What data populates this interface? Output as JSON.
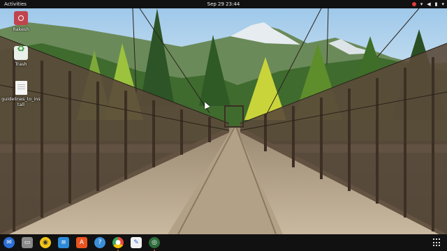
{
  "topbar": {
    "activities_label": "Activities",
    "clock": "Sep 29  23:44"
  },
  "desktop": {
    "icons": [
      {
        "label": "Rakesh",
        "icon": "home-folder-icon"
      },
      {
        "label": "Trash",
        "icon": "trash-icon"
      },
      {
        "label": "guidelines_to_install",
        "icon": "text-file-icon"
      }
    ]
  },
  "dock": {
    "apps": [
      {
        "name": "thunderbird",
        "color": "#2a6fd6"
      },
      {
        "name": "files",
        "color": "#8a8a8a"
      },
      {
        "name": "rhythmbox",
        "color": "#f0c419"
      },
      {
        "name": "libreoffice-writer",
        "color": "#2d8ad8"
      },
      {
        "name": "software-center",
        "color": "#e95420"
      },
      {
        "name": "help",
        "color": "#3b8ed8"
      },
      {
        "name": "chrome",
        "color": "#e64a3b"
      },
      {
        "name": "text-editor",
        "color": "#f2f2f2"
      },
      {
        "name": "screenshot-tool",
        "color": "#2e6b3a"
      }
    ]
  },
  "colors": {
    "panel": "#111111",
    "accent": "#e95420",
    "record_indicator": "#e23b3b"
  }
}
